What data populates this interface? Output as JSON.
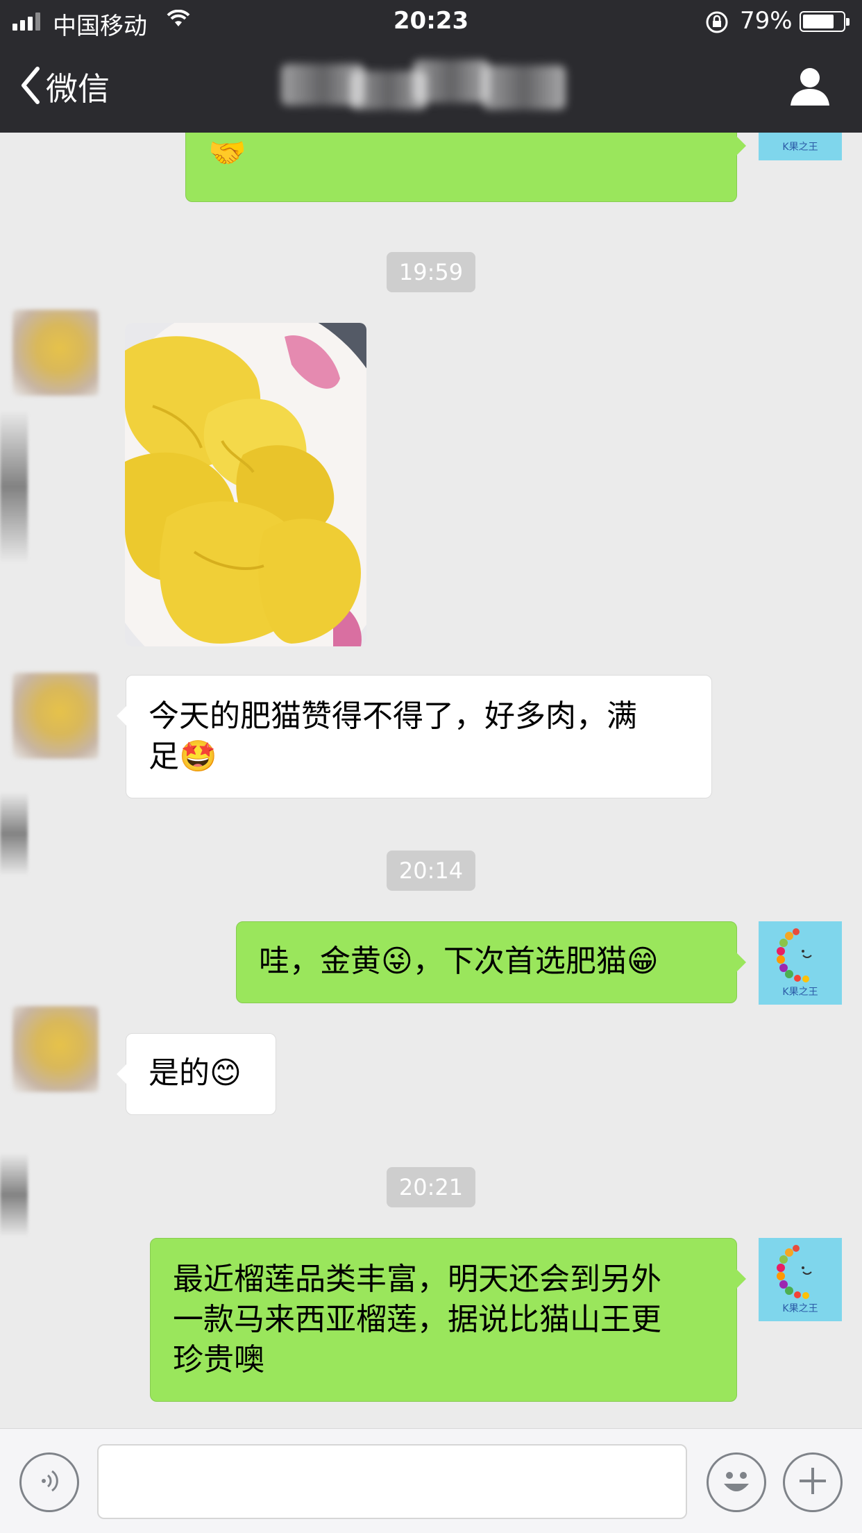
{
  "status_bar": {
    "carrier": "中国移动",
    "time": "20:23",
    "battery_percent": "79%",
    "battery_level": 0.79
  },
  "nav": {
    "back_label": "微信",
    "title": "",
    "icons": {
      "back": "chevron-left-icon",
      "profile": "person-icon"
    }
  },
  "messages": [
    {
      "id": "m0",
      "side": "out",
      "type": "text",
      "text": "🤝"
    },
    {
      "id": "t1",
      "type": "timestamp",
      "text": "19:59"
    },
    {
      "id": "m1",
      "side": "in",
      "type": "image",
      "description": "photo"
    },
    {
      "id": "m2",
      "side": "in",
      "type": "text",
      "line1": "今天的肥猫赞得不得了，好多肉，满",
      "line2": "足🤩"
    },
    {
      "id": "t2",
      "type": "timestamp",
      "text": "20:14"
    },
    {
      "id": "m3",
      "side": "out",
      "type": "text",
      "text": "哇，金黄😜，下次首选肥猫😁"
    },
    {
      "id": "m4",
      "side": "in",
      "type": "text",
      "text": "是的😊"
    },
    {
      "id": "t3",
      "type": "timestamp",
      "text": "20:21"
    },
    {
      "id": "m5",
      "side": "out",
      "type": "text",
      "line1": "最近榴莲品类丰富，明天还会到另外",
      "line2": "一款马来西亚榴莲，据说比猫山王更",
      "line3": "珍贵噢"
    }
  ],
  "avatar_right": {
    "brand": "K果之王"
  },
  "input_bar": {
    "value": "",
    "placeholder": "",
    "icons": {
      "voice": "voice-icon",
      "emoji": "emoji-icon",
      "more": "plus-icon"
    }
  },
  "colors": {
    "nav_bg": "#2b2b2f",
    "chat_bg": "#ebebeb",
    "outgoing_bubble": "#9ae65c",
    "incoming_bubble": "#ffffff",
    "timestamp_bg": "#cecece",
    "avatar_bg": "#7fd6ec"
  }
}
